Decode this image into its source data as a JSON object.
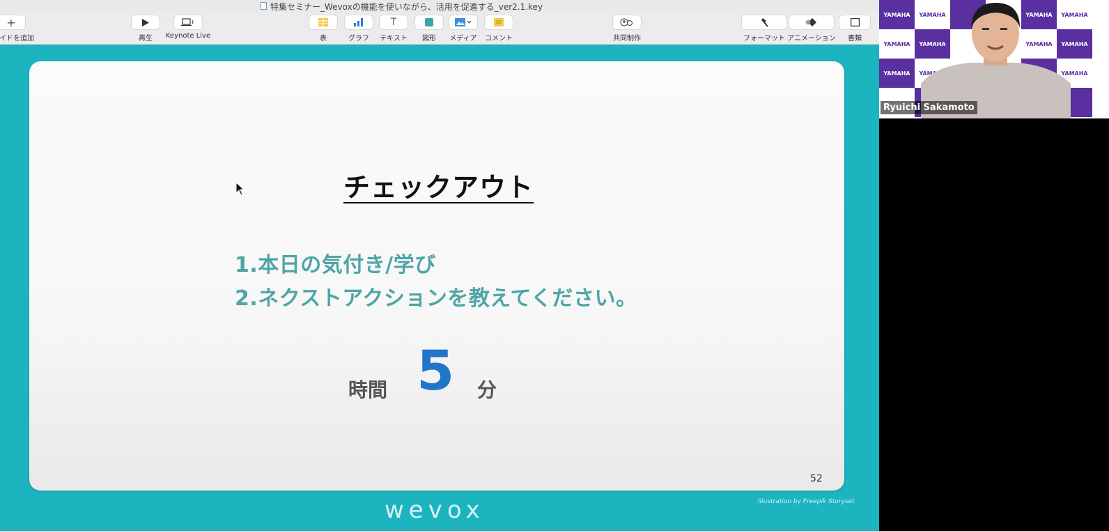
{
  "window": {
    "title": "特集セミナー_Wevoxの機能を使いながら、活用を促進する_ver2.1.key"
  },
  "toolbar": {
    "add_slide": "イドを追加",
    "play": "再生",
    "keynote_live": "Keynote Live",
    "table": "表",
    "chart": "グラフ",
    "text": "テキスト",
    "shape": "図形",
    "media": "メディア",
    "comment": "コメント",
    "collaborate": "共同制作",
    "format": "フォーマット",
    "animate": "アニメーション",
    "document": "書類"
  },
  "slide": {
    "title": "チェックアウト",
    "items": [
      "1.本日の気付き/学び",
      "2.ネクストアクションを教えてください。"
    ],
    "time_label": "時間",
    "time_value": "5",
    "time_unit": "分",
    "slide_number": "52",
    "logo": "wevox",
    "credit": "Illustration by Freepik Storyset"
  },
  "video": {
    "participant_name": "Ryuichi Sakamoto",
    "backdrop_text": "YAMAHA"
  },
  "colors": {
    "teal": "#1bb4bf",
    "item_text": "#4fa5a6",
    "time_value": "#2176c7",
    "yamaha_purple": "#5a2f9f"
  }
}
